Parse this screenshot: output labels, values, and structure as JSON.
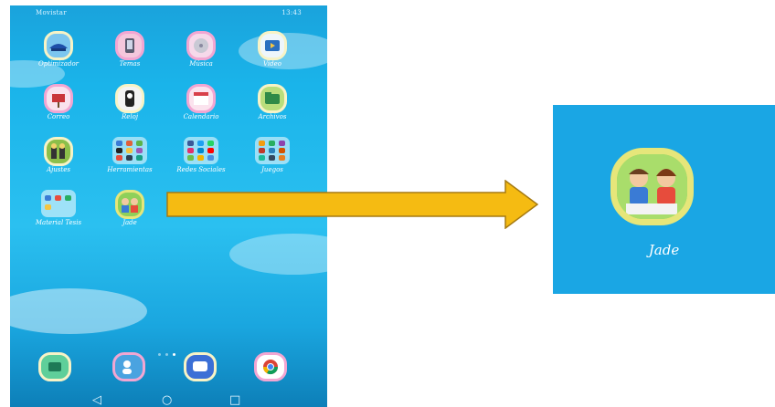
{
  "status_bar": {
    "carrier": "Movistar",
    "indicators": "",
    "time": "13:43"
  },
  "home_apps": [
    {
      "label": "Optimizador",
      "icon": "optimizer-icon"
    },
    {
      "label": "Temas",
      "icon": "themes-icon"
    },
    {
      "label": "Música",
      "icon": "music-icon"
    },
    {
      "label": "Video",
      "icon": "video-icon"
    },
    {
      "label": "Correo",
      "icon": "mail-icon"
    },
    {
      "label": "Reloj",
      "icon": "clock-icon"
    },
    {
      "label": "Calendario",
      "icon": "calendar-icon"
    },
    {
      "label": "Archivos",
      "icon": "files-icon"
    },
    {
      "label": "Ajustes",
      "icon": "settings-icon"
    },
    {
      "label": "Herramientas",
      "icon": "tools-folder-icon"
    },
    {
      "label": "Redes Sociales",
      "icon": "social-folder-icon"
    },
    {
      "label": "Juegos",
      "icon": "games-folder-icon"
    },
    {
      "label": "Material Tesis",
      "icon": "thesis-folder-icon"
    },
    {
      "label": "Jade",
      "icon": "jade-app-icon"
    }
  ],
  "dock": [
    {
      "icon": "phone-icon"
    },
    {
      "icon": "contacts-icon"
    },
    {
      "icon": "messages-icon"
    },
    {
      "icon": "browser-icon"
    }
  ],
  "page_indicator": {
    "pages": 3,
    "current": 3
  },
  "nav_bar": {
    "back": "◁",
    "home": "○",
    "recent": "□"
  },
  "zoomed_app": {
    "label": "Jade",
    "icon": "jade-app-icon"
  },
  "colors": {
    "arrow": "#f5bb12",
    "background": "#1aa6e4"
  }
}
